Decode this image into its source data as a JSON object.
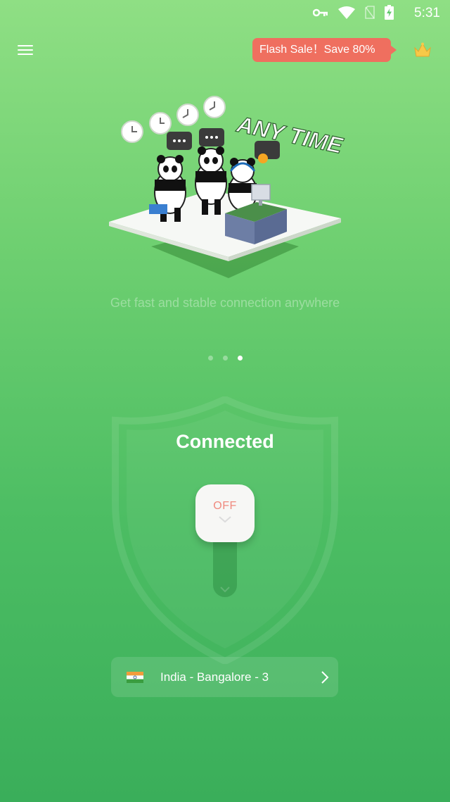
{
  "status_bar": {
    "time": "5:31",
    "icons": [
      "vpn-key-icon",
      "wifi-icon",
      "no-sim-icon",
      "battery-charging-icon"
    ]
  },
  "header": {
    "menu_icon": "hamburger-menu-icon",
    "promo_label": "Flash Sale！Save 80%",
    "promo_color": "#ef6f5f",
    "vip_icon": "crown-icon"
  },
  "carousel": {
    "illustration_text": "ANY TIME",
    "tagline": "Get fast and stable connection anywhere",
    "page_count": 3,
    "active_page": 3
  },
  "connection": {
    "status": "Connected",
    "toggle_label": "OFF",
    "toggle_label_color": "#f08a7e"
  },
  "server": {
    "flag_icon": "india-flag-icon",
    "name": "India - Bangalore - 3",
    "chevron_icon": "chevron-right-icon"
  },
  "colors": {
    "background_top": "#8fdf84",
    "background_bottom": "#3aae5a"
  }
}
